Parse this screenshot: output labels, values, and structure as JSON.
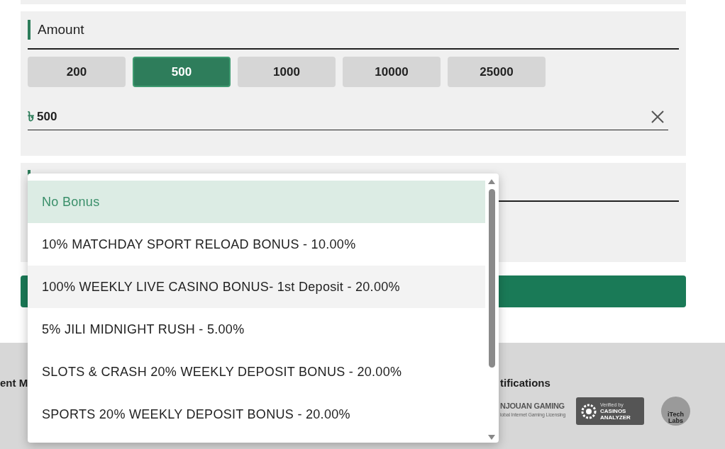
{
  "amount": {
    "title": "Amount",
    "presets": [
      {
        "label": "200",
        "selected": false
      },
      {
        "label": "500",
        "selected": true
      },
      {
        "label": "1000",
        "selected": false
      },
      {
        "label": "10000",
        "selected": false
      },
      {
        "label": "25000",
        "selected": false
      }
    ],
    "currency": "৳",
    "value": "500"
  },
  "bonus_dropdown": {
    "options": [
      {
        "label": "No Bonus",
        "selected": true,
        "hovered": false
      },
      {
        "label": "10% MATCHDAY SPORT RELOAD BONUS - 10.00%",
        "selected": false,
        "hovered": false
      },
      {
        "label": "100% WEEKLY LIVE CASINO BONUS- 1st Deposit - 20.00%",
        "selected": false,
        "hovered": true
      },
      {
        "label": "5% JILI MIDNIGHT RUSH - 5.00%",
        "selected": false,
        "hovered": false
      },
      {
        "label": "SLOTS & CRASH 20% WEEKLY DEPOSIT BONUS - 20.00%",
        "selected": false,
        "hovered": false
      },
      {
        "label": "SPORTS 20% WEEKLY DEPOSIT BONUS - 20.00%",
        "selected": false,
        "hovered": false
      }
    ]
  },
  "footer": {
    "column_1_heading": "ent M",
    "column_2_heading": "tifications",
    "logos": [
      {
        "title": "NJOUAN GAMING",
        "subtitle": "lobal Internet Gaming Licensing"
      },
      {
        "title": "CASINOS ANALYZER",
        "subtitle": "Verified by"
      },
      {
        "title": "iTech Labs"
      }
    ]
  }
}
